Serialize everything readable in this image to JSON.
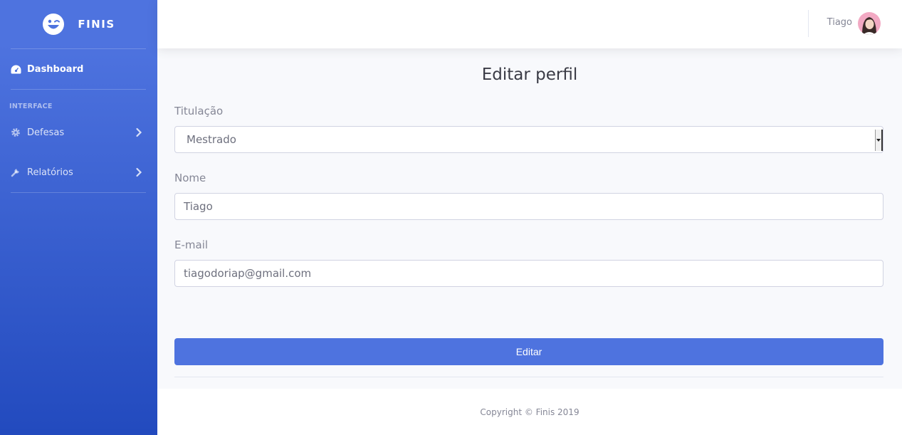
{
  "sidebar": {
    "brand": "FINIS",
    "dashboard_label": "Dashboard",
    "section_heading": "INTERFACE",
    "items": [
      {
        "label": "Defesas",
        "icon": "gear-icon"
      },
      {
        "label": "Relatórios",
        "icon": "wrench-icon"
      }
    ]
  },
  "topbar": {
    "user_name": "Tiago"
  },
  "form": {
    "title": "Editar perfil",
    "titulacao_label": "Titulação",
    "titulacao_value": "Mestrado",
    "nome_label": "Nome",
    "nome_value": "Tiago",
    "email_label": "E-mail",
    "email_value": "tiagodoriap@gmail.com",
    "submit_label": "Editar"
  },
  "footer": {
    "copyright": "Copyright © Finis 2019"
  },
  "colors": {
    "primary": "#4e73df",
    "sidebar_gradient_end": "#224abe"
  }
}
